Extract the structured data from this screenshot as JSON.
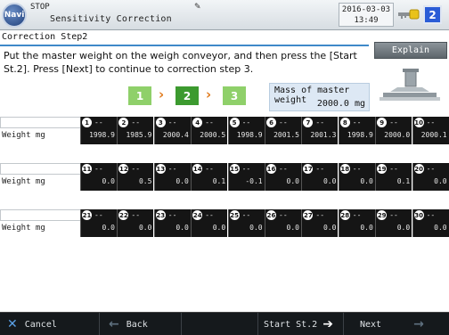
{
  "header": {
    "nav_label": "Navi",
    "state": "STOP",
    "title": "Sensitivity Correction",
    "date": "2016-03-03",
    "time": "13:49",
    "badge": "2",
    "pencil": "✎"
  },
  "step_title": "Correction Step2",
  "explain_label": "Explain",
  "instruction": "Put the master weight on the weigh conveyor, and then press the [Start St.2]. Press [Next] to continue to correction step 3.",
  "steps": [
    {
      "label": "1",
      "color": "#8fd06a"
    },
    {
      "label": "2",
      "color": "#3c9a2f"
    },
    {
      "label": "3",
      "color": "#8fd06a"
    }
  ],
  "step_arrows": [
    "›",
    "›"
  ],
  "mass": {
    "label": "Mass of master weight",
    "value": "2000.0 mg"
  },
  "weight_label": "Weight mg",
  "rows": [
    {
      "heads": [
        "1",
        "2",
        "3",
        "4",
        "5",
        "6",
        "7",
        "8",
        "9",
        "10"
      ],
      "values": [
        "1998.9",
        "1985.9",
        "2000.4",
        "2000.5",
        "1998.9",
        "2001.5",
        "2001.3",
        "1998.9",
        "2000.0",
        "2000.1"
      ]
    },
    {
      "heads": [
        "11",
        "12",
        "13",
        "14",
        "15",
        "16",
        "17",
        "18",
        "19",
        "20"
      ],
      "values": [
        "0.0",
        "0.5",
        "0.0",
        "0.1",
        "-0.1",
        "0.0",
        "0.0",
        "0.0",
        "0.1",
        "0.0"
      ]
    },
    {
      "heads": [
        "21",
        "22",
        "23",
        "24",
        "25",
        "26",
        "27",
        "28",
        "29",
        "30"
      ],
      "values": [
        "0.0",
        "0.0",
        "0.0",
        "0.0",
        "0.0",
        "0.0",
        "0.0",
        "0.0",
        "0.0",
        "0.0"
      ]
    }
  ],
  "head_dash": "--",
  "footer": {
    "cancel": "Cancel",
    "back": "Back",
    "start": "Start St.2",
    "next": "Next",
    "cancel_icon": "✕",
    "back_icon": "←",
    "start_icon": "➔",
    "next_icon": "→"
  }
}
